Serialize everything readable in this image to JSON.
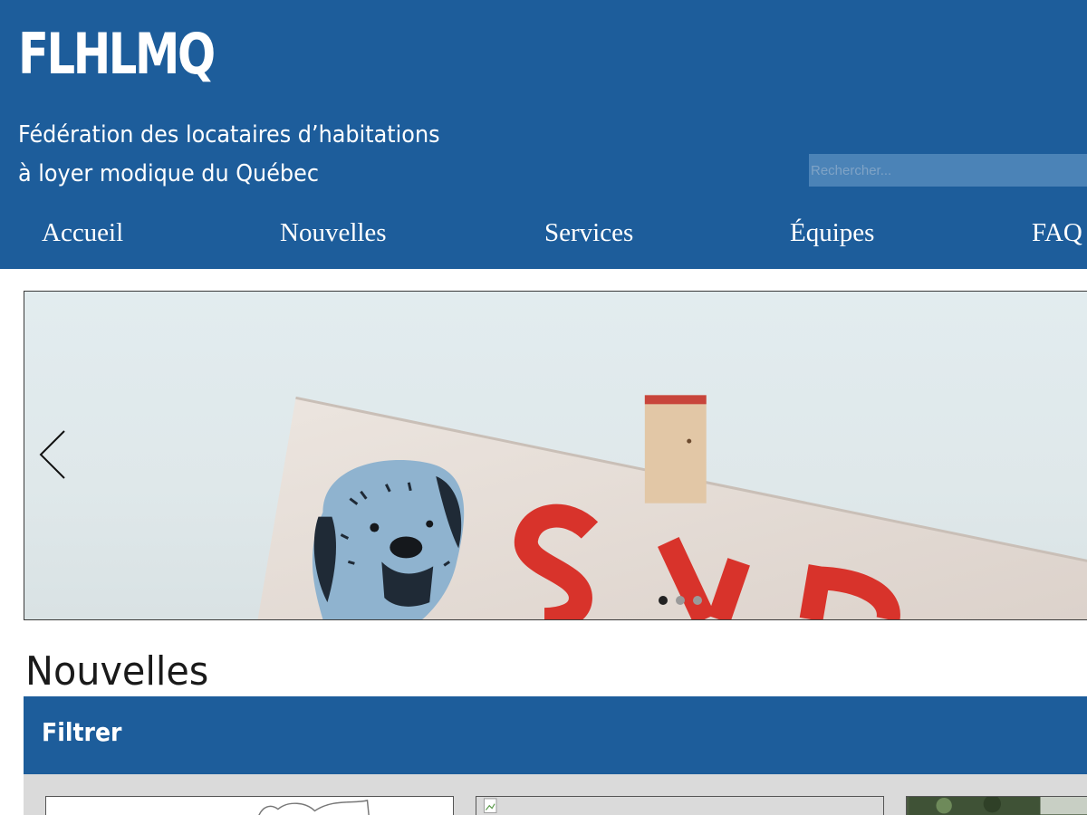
{
  "header": {
    "logo_text": "FLHLMQ",
    "tagline_line1": "Fédération des locataires d’habitations",
    "tagline_line2": "à loyer modique du Québec",
    "brand_color": "#1d5d9b"
  },
  "search": {
    "placeholder": "Rechercher...",
    "value": ""
  },
  "nav": {
    "items": [
      {
        "label": "Accueil"
      },
      {
        "label": "Nouvelles"
      },
      {
        "label": "Services"
      },
      {
        "label": "Équipes"
      },
      {
        "label": "FAQ"
      }
    ]
  },
  "slider": {
    "prev_icon": "chevron-left-icon",
    "slide_count": 3,
    "active_slide": 1,
    "sign_text": "S V P"
  },
  "news": {
    "title": "Nouvelles",
    "filter_label": "Filtrer",
    "cards": [
      {
        "thumb": "sketch-thumbnail"
      },
      {
        "thumb": "broken-image-icon"
      },
      {
        "thumb": "photo-thumbnail"
      }
    ]
  }
}
